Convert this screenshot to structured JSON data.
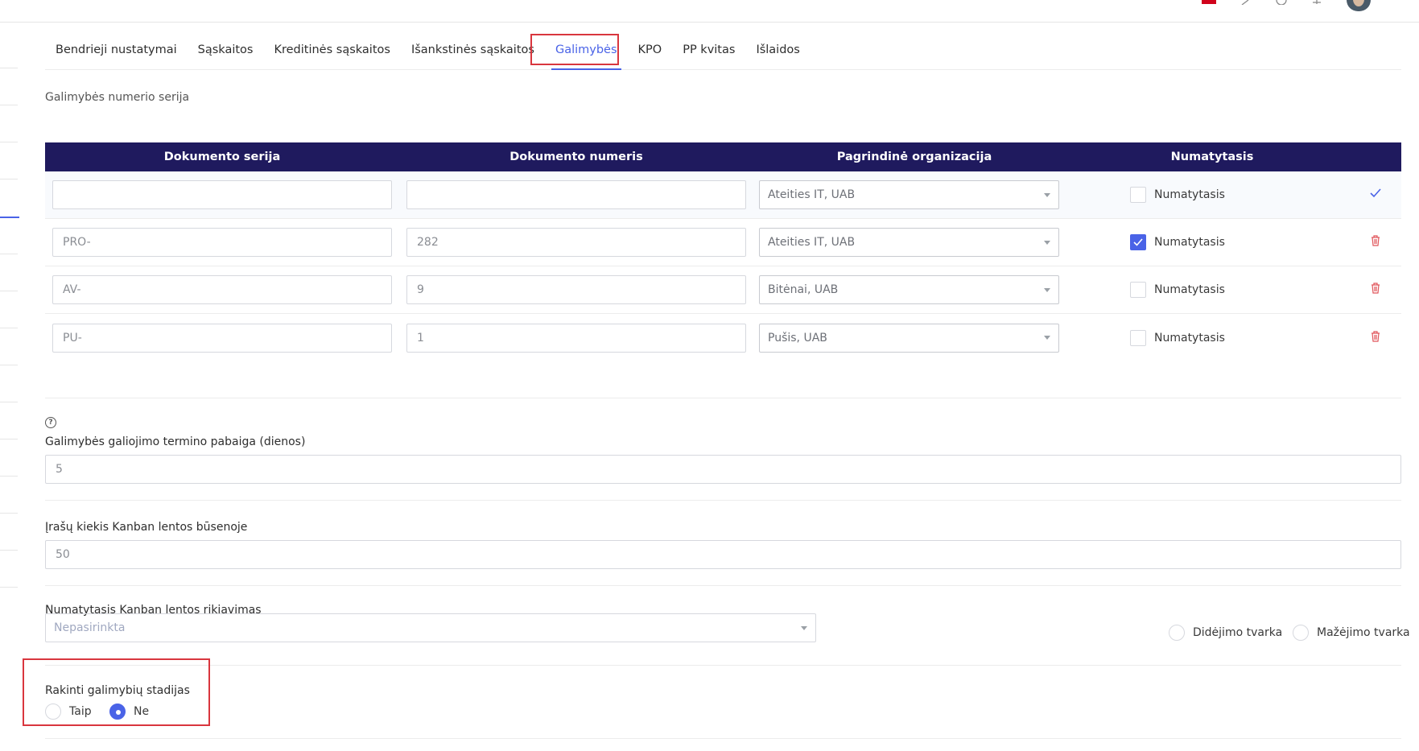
{
  "colors": {
    "accent": "#4a63e7",
    "table_header": "#1f1a5e",
    "delete": "#e0555a",
    "highlight": "#d9363e"
  },
  "header": {
    "icons": [
      "flag-icon",
      "pencil-icon",
      "clock-icon",
      "bell-icon",
      "avatar"
    ]
  },
  "tabs": [
    {
      "label": "Bendrieji nustatymai",
      "active": false
    },
    {
      "label": "Sąskaitos",
      "active": false
    },
    {
      "label": "Kreditinės sąskaitos",
      "active": false
    },
    {
      "label": "Išankstinės sąskaitos",
      "active": false
    },
    {
      "label": "Galimybės",
      "active": true
    },
    {
      "label": "KPO",
      "active": false
    },
    {
      "label": "PP kvitas",
      "active": false
    },
    {
      "label": "Išlaidos",
      "active": false
    }
  ],
  "series_section": {
    "title": "Galimybės numerio serija"
  },
  "table": {
    "headers": [
      "Dokumento serija",
      "Dokumento numeris",
      "Pagrindinė organizacija",
      "Numatytasis"
    ],
    "rows": [
      {
        "series": "",
        "number": "",
        "organization": "Ateities IT, UAB",
        "default_label": "Numatytasis",
        "default_checked": false,
        "action": "confirm-icon"
      },
      {
        "series": "PRO-",
        "number": "282",
        "organization": "Ateities IT, UAB",
        "default_label": "Numatytasis",
        "default_checked": true,
        "action": "trash-icon"
      },
      {
        "series": "AV-",
        "number": "9",
        "organization": "Bitėnai, UAB",
        "default_label": "Numatytasis",
        "default_checked": false,
        "action": "trash-icon"
      },
      {
        "series": "PU-",
        "number": "1",
        "organization": "Pušis, UAB",
        "default_label": "Numatytasis",
        "default_checked": false,
        "action": "trash-icon"
      }
    ]
  },
  "validity": {
    "help_icon": "?",
    "label": "Galimybės galiojimo termino pabaiga (dienos)",
    "value": "5"
  },
  "kanban_count": {
    "label": "Įrašų kiekis Kanban lentos būsenoje",
    "value": "50"
  },
  "kanban_sort": {
    "label": "Numatytasis Kanban lentos rikiavimas",
    "placeholder": "Nepasirinkta",
    "options": [
      {
        "label": "Didėjimo tvarka",
        "selected": false
      },
      {
        "label": "Mažėjimo tvarka",
        "selected": false
      }
    ]
  },
  "lock_stages": {
    "label": "Rakinti galimybių stadijas",
    "options": [
      {
        "label": "Taip",
        "selected": false
      },
      {
        "label": "Ne",
        "selected": true
      }
    ]
  }
}
